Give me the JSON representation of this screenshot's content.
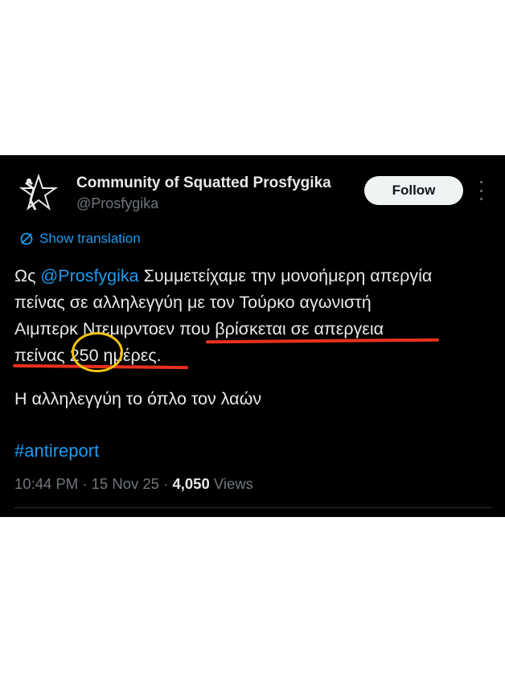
{
  "tweet": {
    "display_name": "Community of Squatted Prosfygika",
    "handle": "@Prosfygika",
    "follow_label": "Follow",
    "translate_label": "Show translation",
    "body_lines": {
      "line1_prefix": "Ως ",
      "line1_mention": "@Prosfygika",
      "line1_rest": " Συμμετείχαμε την μονοήμερη απεργία",
      "line2": "πείνας σε αλληλεγγύη με τον Τούρκο αγωνιστή",
      "line3": "Αιμπερκ Ντεμιρντοεν που βρίσκεται σε απεργεια",
      "line4": "πείνας 250 ημέρες."
    },
    "paragraph2": "Η αλληλεγγύη το όπλο τον λαών",
    "hashtag": "#antireport",
    "time": "10:44 PM",
    "date": "15 Nov 25",
    "views_count": "4,050",
    "views_label": "Views"
  },
  "annotations": {
    "underline_color": "#e8301c",
    "circle_color": "#f1c40f"
  }
}
